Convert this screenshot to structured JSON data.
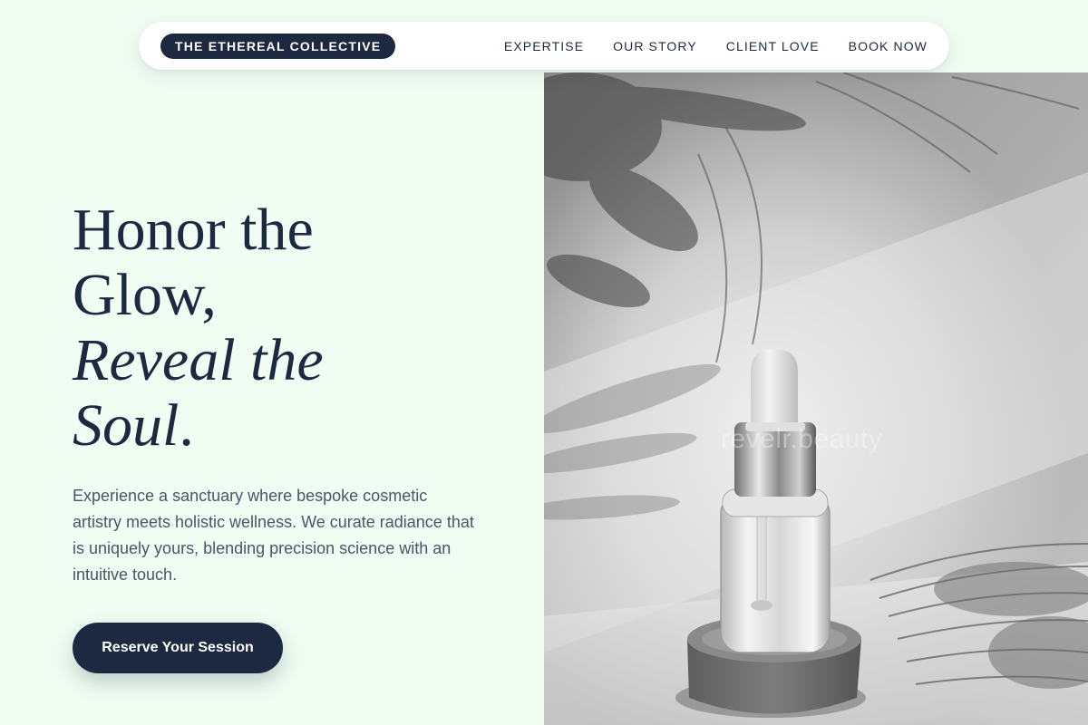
{
  "header": {
    "brand": "THE ETHEREAL COLLECTIVE",
    "nav": [
      {
        "label": "EXPERTISE"
      },
      {
        "label": "OUR STORY"
      },
      {
        "label": "CLIENT LOVE"
      },
      {
        "label": "BOOK NOW"
      }
    ]
  },
  "hero": {
    "headline_line1": "Honor the",
    "headline_line2": "Glow,",
    "headline_line3": "Reveal the",
    "headline_line4": "Soul",
    "headline_period": ".",
    "description": "Experience a sanctuary where bespoke cosmetic artistry meets holistic wellness. We curate radiance that is uniquely yours, blending precision science with an intuitive touch.",
    "cta_label": "Reserve Your Session",
    "image_watermark": "revelr.beauty"
  },
  "colors": {
    "background": "#effdf2",
    "navy": "#1c2940",
    "body_text": "#4a5568"
  }
}
